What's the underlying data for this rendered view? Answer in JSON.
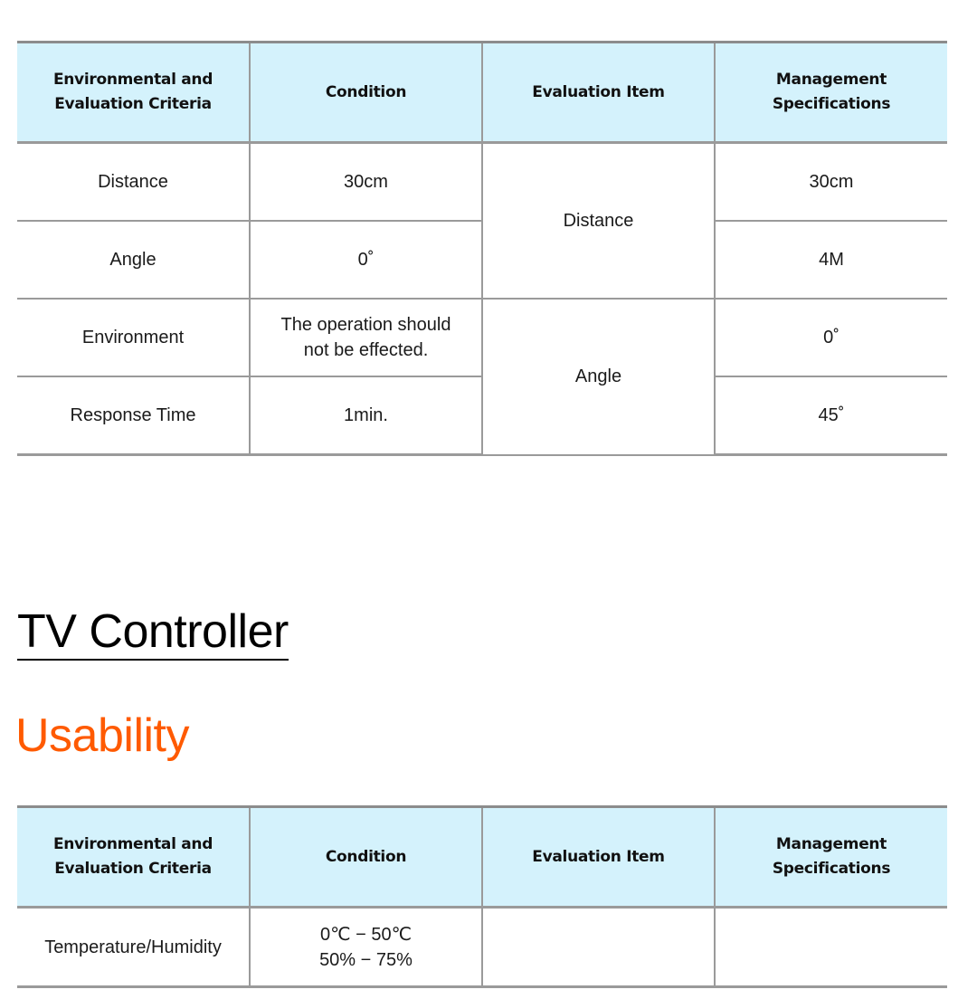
{
  "colors": {
    "header_bg": "#d4f2fc",
    "accent_orange": "#ff5a00",
    "border_gray": "#9a9a9a"
  },
  "table1": {
    "headers": [
      "Environmental and\nEvaluation Criteria",
      "Condition",
      "Evaluation Item",
      "Management\nSpecifications"
    ],
    "rows": [
      {
        "criteria": "Distance",
        "condition": "30cm",
        "spec": "30cm"
      },
      {
        "criteria": "Angle",
        "condition": "0˚",
        "spec": "4M"
      },
      {
        "criteria": "Environment",
        "condition": "The operation should not be effected.",
        "spec": "0˚"
      },
      {
        "criteria": "Response Time",
        "condition": "1min.",
        "spec": "45˚"
      }
    ],
    "evaluation_items": [
      "Distance",
      "Angle"
    ]
  },
  "section_title": "TV Controller",
  "subsection_title": "Usability",
  "table2": {
    "headers": [
      "Environmental and\nEvaluation Criteria",
      "Condition",
      "Evaluation Item",
      "Management\nSpecifications"
    ],
    "rows": [
      {
        "criteria": "Temperature/Humidity",
        "condition_line1": "0℃ − 50℃",
        "condition_line2": "50% − 75%",
        "evaluation_item": "",
        "spec": ""
      }
    ]
  }
}
